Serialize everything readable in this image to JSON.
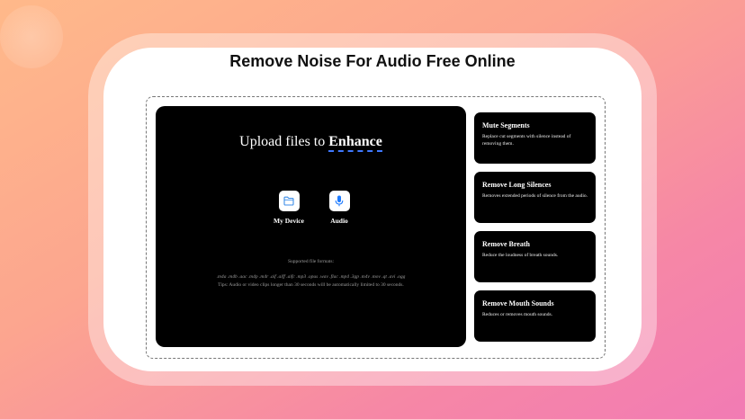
{
  "header": {
    "title": "Remove Noise For Audio Free Online"
  },
  "upload": {
    "heading_prefix": "Upload files to ",
    "heading_accent": "Enhance",
    "sources": [
      {
        "label": "My Device",
        "icon": "folder-icon"
      },
      {
        "label": "Audio",
        "icon": "microphone-icon"
      }
    ],
    "formats_label": "Supported file formats:",
    "formats": ".m4a .m4b .aac .m4p .m4r .aif .aiff .aifc .mp3 .opus .wav .flac .mp4 .3gp .m4v .mov .qt .avi .ogg",
    "tips": "Tips: Audio or video clips longer than 30 seconds will be automatically limited to 30 seconds."
  },
  "features": [
    {
      "title": "Mute Segments",
      "desc": "Replace cut segments with silence instead of removing them."
    },
    {
      "title": "Remove Long Silences",
      "desc": "Removes extended periods of silence from the audio."
    },
    {
      "title": "Remove Breath",
      "desc": "Reduce the loudness of breath sounds."
    },
    {
      "title": "Remove Mouth Sounds",
      "desc": "Reduces or removes mouth sounds."
    }
  ],
  "colors": {
    "accent": "#3f78ff",
    "mic": "#1e7bff",
    "folder": "#3d8ee8"
  }
}
